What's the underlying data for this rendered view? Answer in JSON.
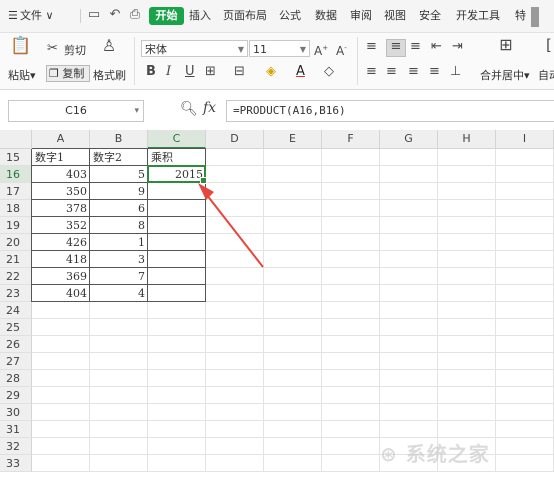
{
  "menu": {
    "file": "文件",
    "tabs": [
      "开始",
      "插入",
      "页面布局",
      "公式",
      "数据",
      "审阅",
      "视图",
      "安全",
      "开发工具",
      "特"
    ]
  },
  "ribbon": {
    "paste": "粘贴",
    "cut": "剪切",
    "copy": "复制",
    "format_painter": "格式刷",
    "font_name": "宋体",
    "font_size": "11",
    "merge_center": "合并居中",
    "auto_wrap": "自动"
  },
  "formula_bar": {
    "cell_ref": "C16",
    "fx": "fx",
    "formula": "=PRODUCT(A16,B16)"
  },
  "sheet": {
    "columns": [
      "A",
      "B",
      "C",
      "D",
      "E",
      "F",
      "G",
      "H",
      "I"
    ],
    "rows": [
      15,
      16,
      17,
      18,
      19,
      20,
      21,
      22,
      23,
      24,
      25,
      26,
      27,
      28,
      29,
      30,
      31,
      32,
      33
    ],
    "selected_cell": "C16",
    "headers": {
      "a": "数字1",
      "b": "数字2",
      "c": "乘积"
    },
    "data": [
      {
        "row": 16,
        "a": "403",
        "b": "5",
        "c": "2015"
      },
      {
        "row": 17,
        "a": "350",
        "b": "9",
        "c": ""
      },
      {
        "row": 18,
        "a": "378",
        "b": "6",
        "c": ""
      },
      {
        "row": 19,
        "a": "352",
        "b": "8",
        "c": ""
      },
      {
        "row": 20,
        "a": "426",
        "b": "1",
        "c": ""
      },
      {
        "row": 21,
        "a": "418",
        "b": "3",
        "c": ""
      },
      {
        "row": 22,
        "a": "369",
        "b": "7",
        "c": ""
      },
      {
        "row": 23,
        "a": "404",
        "b": "4",
        "c": ""
      }
    ]
  },
  "annotation_color": "#e8453c",
  "accent_color": "#1aa34a",
  "watermark": "系统之家"
}
